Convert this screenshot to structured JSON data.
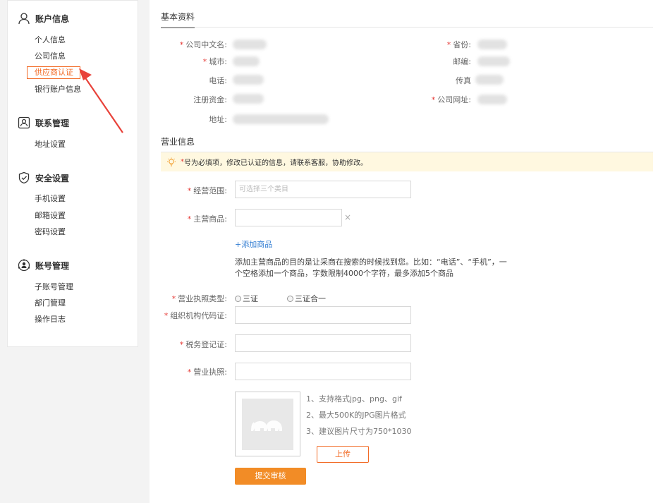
{
  "sidebar": {
    "groups": [
      {
        "title": "账户信息",
        "icon": "user-icon",
        "items": [
          "个人信息",
          "公司信息",
          "供应商认证",
          "银行账户信息"
        ]
      },
      {
        "title": "联系管理",
        "icon": "contact-card-icon",
        "items": [
          "地址设置"
        ]
      },
      {
        "title": "安全设置",
        "icon": "shield-check-icon",
        "items": [
          "手机设置",
          "邮箱设置",
          "密码设置"
        ]
      },
      {
        "title": "账号管理",
        "icon": "account-network-icon",
        "items": [
          "子账号管理",
          "部门管理",
          "操作日志"
        ]
      }
    ],
    "active_item": "供应商认证",
    "accent_color": "#f26b26"
  },
  "basic": {
    "title": "基本资料",
    "fields": {
      "company_cn": "公司中文名:",
      "province": "省份:",
      "city": "城市:",
      "postcode": "邮编:",
      "phone": "电话:",
      "fax": "传真",
      "capital": "注册资金:",
      "website": "公司网址:",
      "address": "地址:"
    }
  },
  "business": {
    "title": "营业信息",
    "notice_star": "*",
    "notice": "号为必填项，修改已认证的信息，请联系客服，协助修改。",
    "scope_label": "经营范围:",
    "scope_placeholder": "可选择三个类目",
    "products_label": "主营商品:",
    "remove_icon": "×",
    "add_product": "+添加商品",
    "help_text": "添加主营商品的目的是让采商在搜索的时候找到您。比如：“电话”、“手机”，一个空格添加一个商品，字数限制4000个字符，最多添加5个商品",
    "license_type_label": "营业执照类型:",
    "license_options": [
      "三证",
      "三证合一"
    ],
    "org_code_label": "组织机构代码证:",
    "tax_label": "税务登记证:",
    "license_label": "营业执照:",
    "tips": [
      "1、支持格式jpg、png、gif",
      "2、最大500K的JPG图片格式",
      "3、建议图片尺寸为750*1030"
    ],
    "upload_label": "上传",
    "submit_label": "提交审核"
  }
}
